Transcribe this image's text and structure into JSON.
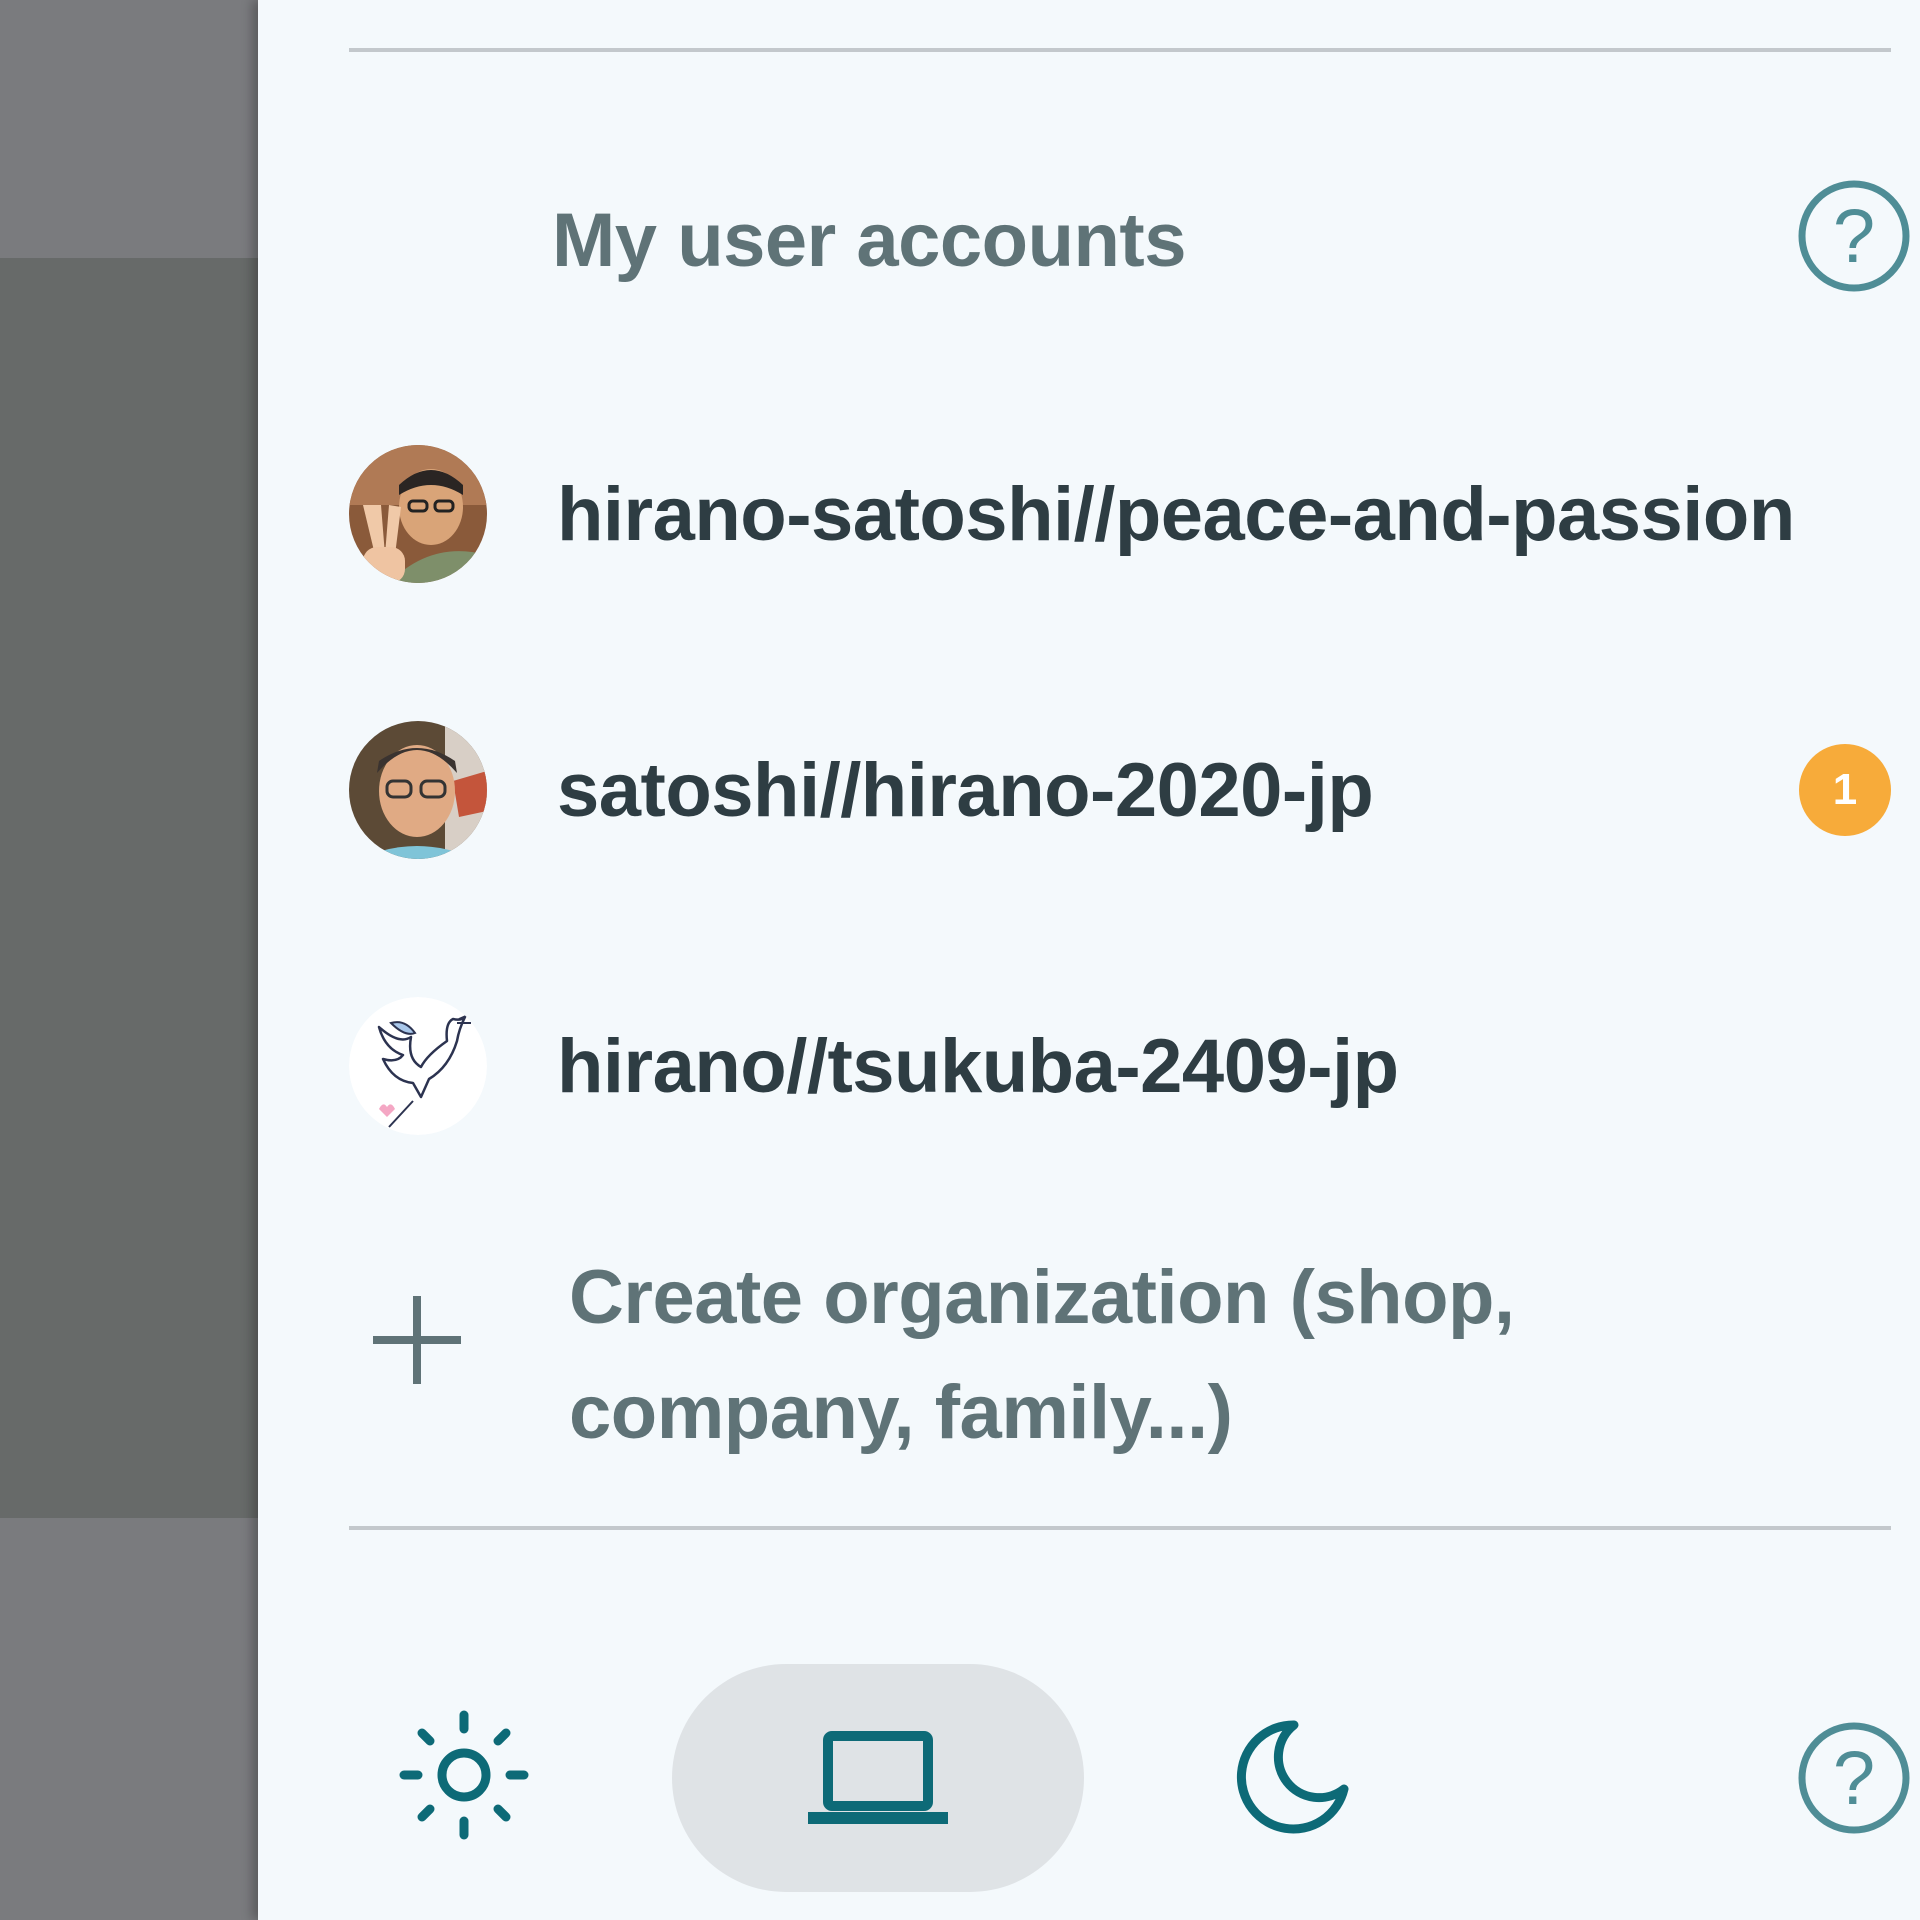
{
  "drawer": {
    "section_title": "My user accounts",
    "accounts": [
      {
        "name": "hirano-satoshi//peace-and-passion",
        "avatar": "user-photo",
        "badge": ""
      },
      {
        "name": "satoshi//hirano-2020-jp",
        "avatar": "user-photo",
        "badge": "1"
      },
      {
        "name": "hirano//tsukuba-2409-jp",
        "avatar": "dove-logo",
        "badge": ""
      }
    ],
    "create_org": {
      "label": "Create organization (shop, company, family...)",
      "icon": "plus-icon"
    },
    "theme_switch": {
      "options": [
        "light",
        "system",
        "dark"
      ],
      "selected": "system",
      "icons": [
        "sun-icon",
        "laptop-icon",
        "moon-icon"
      ]
    }
  },
  "colors": {
    "accent": "#0d6a77",
    "badge": "#f7ab3a",
    "drawer_bg": "#f4f9fc",
    "title_text": "#5f7377",
    "account_text": "#2e3d43"
  }
}
